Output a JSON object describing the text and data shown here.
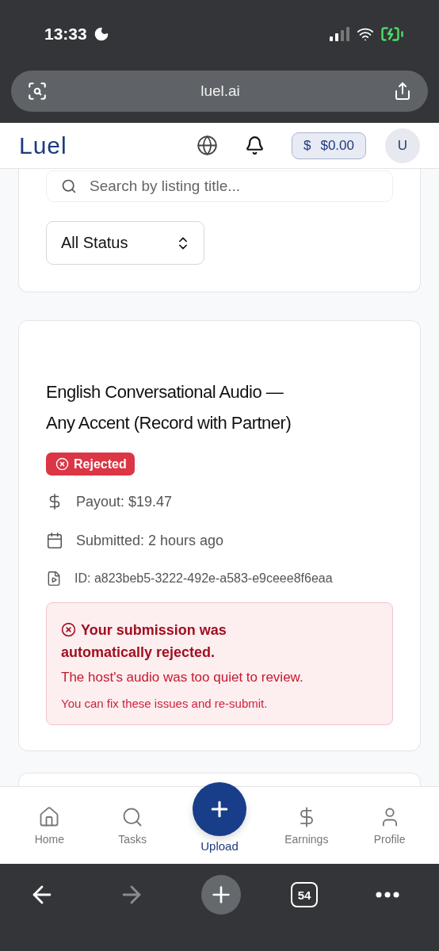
{
  "status_bar": {
    "time": "13:33"
  },
  "browser": {
    "url": "luel.ai",
    "tab_count": "54"
  },
  "header": {
    "logo": "Luel",
    "balance_icon": "$",
    "balance": "$0.00",
    "avatar": "U"
  },
  "filters": {
    "search": {
      "placeholder": "Search by listing title..."
    },
    "status_select": "All Status"
  },
  "submission": {
    "title": "English Conversational Audio — Any Accent (Record with Partner)",
    "status": {
      "label": "Rejected",
      "kind": "rejected"
    },
    "details": [
      {
        "kind": "payout",
        "text": "Payout: $19.47"
      },
      {
        "kind": "date",
        "text": "Submitted: 2 hours ago"
      },
      {
        "kind": "file",
        "text": "ID: a823beb5-3222-492e-a583-e9ceee8f6eaa"
      }
    ],
    "alert": {
      "heading": "Your submission was automatically rejected.",
      "reason": "The host's audio was too quiet to review.",
      "hint": "You can fix these issues and re-submit."
    }
  },
  "bottom_nav": [
    {
      "kind": "home",
      "label": "Home",
      "selected": false
    },
    {
      "kind": "tasks",
      "label": "Tasks",
      "selected": false
    },
    {
      "kind": "upload",
      "label": "Upload",
      "selected": true
    },
    {
      "kind": "earnings",
      "label": "Earnings",
      "selected": false
    },
    {
      "kind": "profile",
      "label": "Profile",
      "selected": false
    }
  ]
}
